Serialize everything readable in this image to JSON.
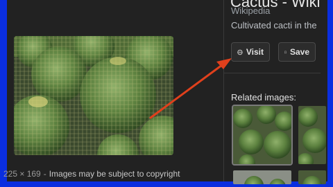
{
  "panel": {
    "title_fragment": "Cactus - Wiki",
    "source": "Wikipedia",
    "description": "Cultivated cacti in the",
    "buttons": {
      "visit_label": "Visit",
      "save_label": "Save"
    }
  },
  "image": {
    "dimensions": "225 × 169",
    "separator": "-",
    "copyright_note": "Images may be subject to copyright"
  },
  "related": {
    "heading": "Related images:"
  },
  "icons": {
    "visit": "globe-icon",
    "save": "bookmark-icon",
    "annotation": "arrow-annotation"
  },
  "colors": {
    "frame": "#0a2ee0",
    "panel": "#222222",
    "arrow": "#e0401c"
  }
}
